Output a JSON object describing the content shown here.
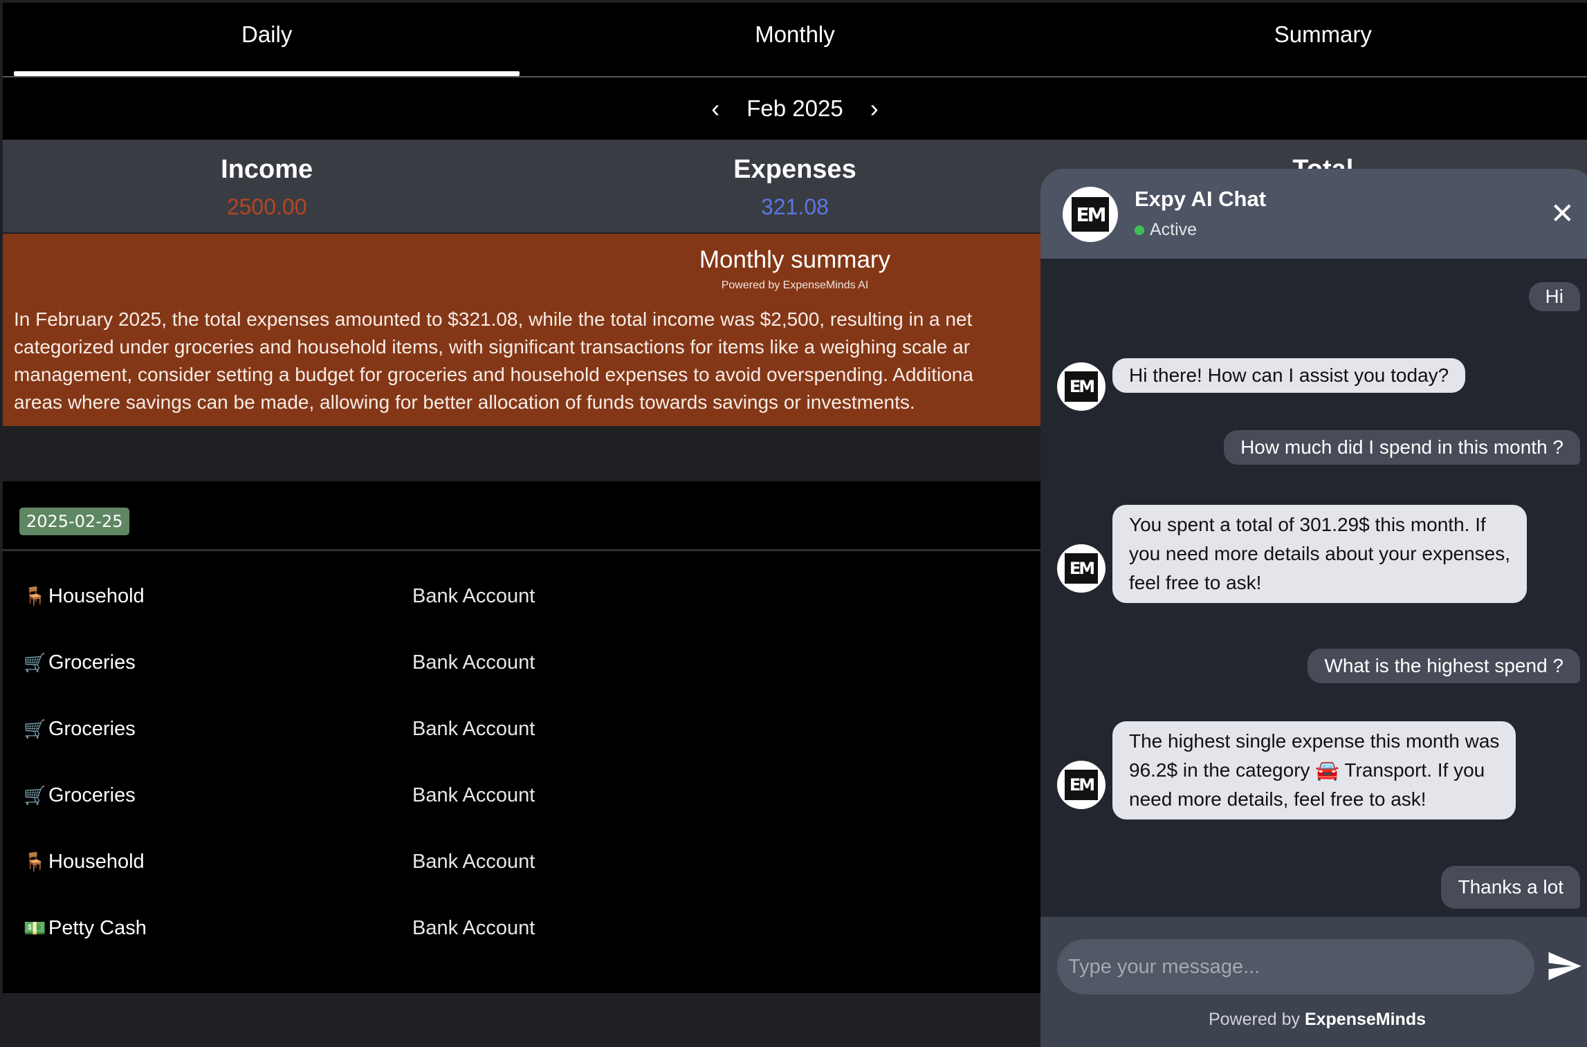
{
  "tabs": [
    "Daily",
    "Monthly",
    "Summary"
  ],
  "active_tab": "Daily",
  "month_nav": {
    "label": "Feb 2025",
    "prev_icon": "chevron-left",
    "next_icon": "chevron-right"
  },
  "totals": {
    "income": {
      "label": "Income",
      "value": "2500.00",
      "color": "#b5461f"
    },
    "expenses": {
      "label": "Expenses",
      "value": "321.08",
      "color": "#5a77e6"
    },
    "total": {
      "label": "Total"
    }
  },
  "summary": {
    "title": "Monthly summary",
    "powered": "Powered by ExpenseMinds AI",
    "lines": [
      "In February 2025, the total expenses amounted to $321.08, while the total income was $2,500, resulting in a net",
      "categorized under groceries and household items, with significant transactions for items like a weighing scale ar",
      "management, consider setting a budget for groceries and household expenses to avoid overspending. Additiona",
      "areas where savings can be made, allowing for better allocation of funds towards savings or investments."
    ]
  },
  "transactions": {
    "date": "2025-02-25",
    "rows": [
      {
        "icon": "🪑",
        "category": "Household",
        "account": "Bank Account"
      },
      {
        "icon": "🛒",
        "category": "Groceries",
        "account": "Bank Account"
      },
      {
        "icon": "🛒",
        "category": "Groceries",
        "account": "Bank Account"
      },
      {
        "icon": "🛒",
        "category": "Groceries",
        "account": "Bank Account"
      },
      {
        "icon": "🪑",
        "category": "Household",
        "account": "Bank Account"
      },
      {
        "icon": "💵",
        "category": "Petty Cash",
        "account": "Bank Account"
      }
    ]
  },
  "chat": {
    "title": "Expy AI Chat",
    "status": "Active",
    "logo_text": "EM",
    "messages": [
      {
        "from": "user",
        "text": "Hi"
      },
      {
        "from": "bot",
        "text": "Hi there! How can I assist you today?"
      },
      {
        "from": "user",
        "text": "How much did I spend in this month ?"
      },
      {
        "from": "bot",
        "lines": [
          "You spent a total of 301.29$ this month. If",
          "you need more details about your expenses,",
          "feel free to ask!"
        ]
      },
      {
        "from": "user",
        "text": "What is the highest spend ?"
      },
      {
        "from": "bot",
        "lines": [
          "The highest single expense this month was",
          "96.2$ in the category 🚘 Transport. If you",
          "need more details, feel free to ask!"
        ]
      },
      {
        "from": "user",
        "text": "Thanks a lot"
      }
    ],
    "input_placeholder": "Type your message...",
    "powered_prefix": "Powered by",
    "powered_brand": "ExpenseMinds"
  }
}
